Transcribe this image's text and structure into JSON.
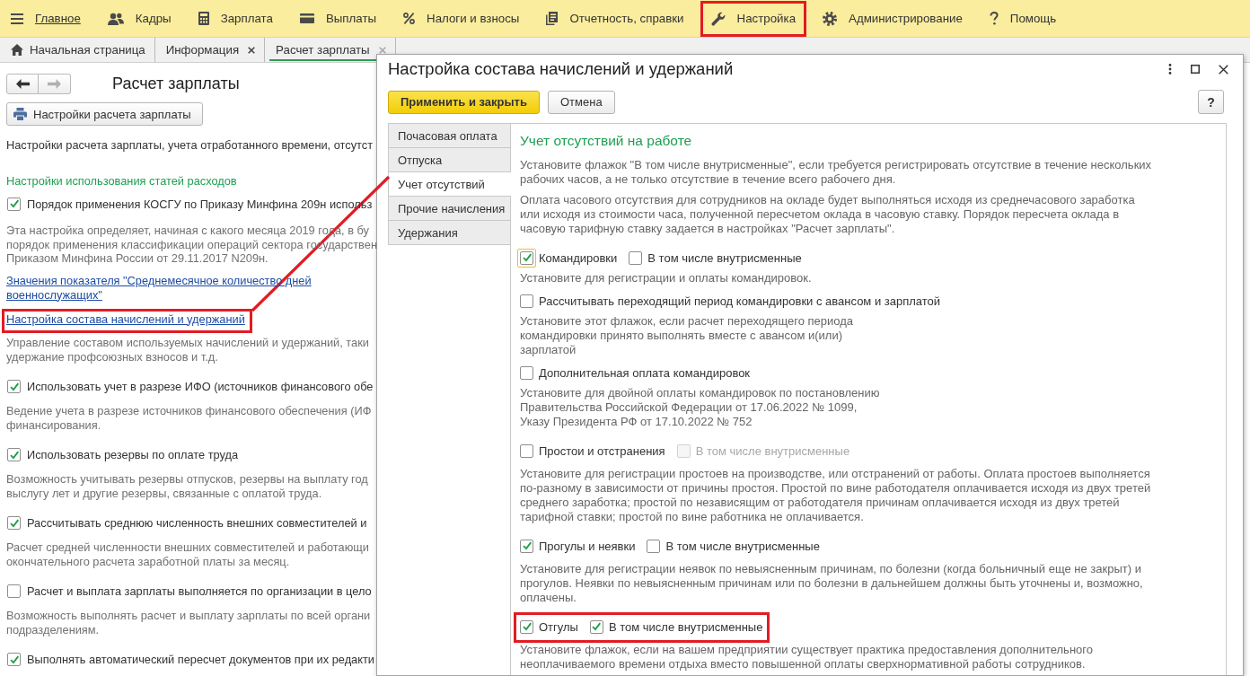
{
  "menu_bar": {
    "items": [
      {
        "label": "Главное",
        "selected": true,
        "highlighted": false
      },
      {
        "label": "Кадры",
        "selected": false,
        "highlighted": false
      },
      {
        "label": "Зарплата",
        "selected": false,
        "highlighted": false
      },
      {
        "label": "Выплаты",
        "selected": false,
        "highlighted": false
      },
      {
        "label": "Налоги и взносы",
        "selected": false,
        "highlighted": false
      },
      {
        "label": "Отчетность, справки",
        "selected": false,
        "highlighted": false
      },
      {
        "label": "Настройка",
        "selected": false,
        "highlighted": true
      },
      {
        "label": "Администрирование",
        "selected": false,
        "highlighted": false
      },
      {
        "label": "Помощь",
        "selected": false,
        "highlighted": false
      }
    ]
  },
  "tabs": [
    {
      "label": "Начальная страница",
      "closable": false,
      "selected": false
    },
    {
      "label": "Информация",
      "closable": true,
      "selected": false
    },
    {
      "label": "Расчет зарплаты",
      "closable": true,
      "selected": true
    }
  ],
  "page": {
    "nav_buttons": [
      {
        "disabled": false
      },
      {
        "disabled": true
      }
    ],
    "title": "Расчет зарплаты",
    "settings_button": "Настройки расчета зарплаты",
    "intro": "Настройки расчета зарплаты, учета отработанного времени, отсутст",
    "items": [
      {
        "kind": "heading",
        "text": "Настройки использования статей расходов"
      },
      {
        "kind": "checkbox",
        "label": "Порядок применения КОСГУ по Приказу Минфина 209н использ",
        "checked": true
      },
      {
        "kind": "description",
        "lines": [
          "Эта настройка определяет, начиная с какого месяца 2019 года, в бу",
          "порядок применения классификации операций сектора государствен",
          "Приказом Минфина России от 29.11.2017 N209н."
        ]
      },
      {
        "kind": "link",
        "lines": [
          "Значения показателя \"Среднемесячное количество дней",
          "военнослужащих\""
        ],
        "highlighted": false
      },
      {
        "kind": "link",
        "lines": [
          "Настройка состава начислений и удержаний"
        ],
        "highlighted": true
      },
      {
        "kind": "description",
        "lines": [
          "Управление составом используемых начислений и удержаний, таки",
          "удержание профсоюзных взносов и т.д."
        ]
      },
      {
        "kind": "checkbox",
        "label": "Использовать учет в разрезе ИФО (источников финансового обе",
        "checked": true
      },
      {
        "kind": "description",
        "lines": [
          "Ведение учета в разрезе источников финансового обеспечения (ИФ",
          "финансирования."
        ]
      },
      {
        "kind": "checkbox",
        "label": "Использовать резервы по оплате труда",
        "checked": true
      },
      {
        "kind": "description",
        "lines": [
          "Возможность учитывать резервы отпусков, резервы на выплату год",
          "выслугу лет и другие резервы, связанные с оплатой труда."
        ]
      },
      {
        "kind": "checkbox",
        "label": "Рассчитывать среднюю численность внешних совместителей и",
        "checked": true
      },
      {
        "kind": "description",
        "lines": [
          "Расчет средней численности внешних совместителей и работающи",
          "окончательного расчета заработной платы за месяц."
        ]
      },
      {
        "kind": "checkbox",
        "label": "Расчет и выплата зарплаты выполняется по организации в цело",
        "checked": false
      },
      {
        "kind": "description",
        "lines": [
          "Возможность выполнять расчет и выплату зарплаты по всей органи",
          "подразделениям."
        ]
      },
      {
        "kind": "checkbox",
        "label": "Выполнять автоматический пересчет документов при их редакти",
        "checked": true
      }
    ]
  },
  "dialog": {
    "title": "Настройка состава начислений и удержаний",
    "apply_button": "Применить и закрыть",
    "cancel_button": "Отмена",
    "help_button": "?",
    "tabs": [
      {
        "label": "Почасовая оплата",
        "selected": false
      },
      {
        "label": "Отпуска",
        "selected": false
      },
      {
        "label": "Учет отсутствий",
        "selected": true
      },
      {
        "label": "Прочие начисления",
        "selected": false
      },
      {
        "label": "Удержания",
        "selected": false
      }
    ],
    "panel": {
      "heading": "Учет отсутствий на работе",
      "notes": [
        {
          "lines": [
            "Установите флажок \"В том числе внутрисменные\", если требуется регистрировать отсутствие в течение нескольких",
            "рабочих часов, а не только отсутствие в течение всего рабочего дня."
          ]
        },
        {
          "lines": [
            "Оплата часового отсутствия для сотрудников на окладе будет выполняться исходя из среднечасового заработка",
            "или исходя из стоимости часа, полученной пересчетом оклада в часовую ставку. Порядок пересчета оклада в",
            "часовую тарифную ставку задается в настройках \"Расчет зарплаты\"."
          ]
        }
      ],
      "groups": [
        {
          "items": [
            {
              "kind": "row",
              "highlighted": false,
              "checks": [
                {
                  "label": "Командировки",
                  "checked": true,
                  "disabled": false,
                  "focused": true
                },
                {
                  "label": "В том числе внутрисменные",
                  "checked": false,
                  "disabled": false,
                  "focused": false
                }
              ]
            },
            {
              "kind": "description",
              "lines": [
                "Установите для регистрации и оплаты командировок."
              ]
            },
            {
              "kind": "row",
              "highlighted": false,
              "checks": [
                {
                  "label": "Рассчитывать переходящий период командировки с авансом и зарплатой",
                  "checked": false,
                  "disabled": false,
                  "focused": false
                }
              ]
            },
            {
              "kind": "description",
              "lines": [
                "Установите этот флажок, если расчет переходящего периода",
                "командировки принято выполнять вместе с авансом и(или)",
                "зарплатой"
              ]
            },
            {
              "kind": "row",
              "highlighted": false,
              "checks": [
                {
                  "label": "Дополнительная оплата командировок",
                  "checked": false,
                  "disabled": false,
                  "focused": false
                }
              ]
            },
            {
              "kind": "description",
              "lines": [
                "Установите для двойной оплаты командировок по постановлению",
                "Правительства Российской Федерации от 17.06.2022 № 1099,",
                "Указу Президента РФ от 17.10.2022 № 752"
              ]
            }
          ]
        },
        {
          "items": [
            {
              "kind": "row",
              "highlighted": false,
              "checks": [
                {
                  "label": "Простои и отстранения",
                  "checked": false,
                  "disabled": false,
                  "focused": false
                },
                {
                  "label": "В том числе внутрисменные",
                  "checked": false,
                  "disabled": true,
                  "focused": false
                }
              ]
            },
            {
              "kind": "description",
              "lines": [
                "Установите для регистрации простоев на производстве, или отстранений от работы. Оплата простоев выполняется",
                "по-разному в зависимости от причины простоя. Простой по вине работодателя оплачивается исходя из двух третей",
                "среднего заработка; простой по независящим от работодателя причинам оплачивается исходя из двух третей",
                "тарифной ставки; простой по вине работника не оплачивается."
              ]
            }
          ]
        },
        {
          "items": [
            {
              "kind": "row",
              "highlighted": false,
              "checks": [
                {
                  "label": "Прогулы и неявки",
                  "checked": true,
                  "disabled": false,
                  "focused": false
                },
                {
                  "label": "В том числе внутрисменные",
                  "checked": false,
                  "disabled": false,
                  "focused": false
                }
              ]
            },
            {
              "kind": "description",
              "lines": [
                "Установите для регистрации неявок по невыясненным причинам, по болезни (когда больничный еще не закрыт) и",
                "прогулов. Неявки по невыясненным причинам или по болезни в дальнейшем должны быть уточнены и, возможно,",
                "оплачены."
              ]
            }
          ]
        },
        {
          "items": [
            {
              "kind": "row",
              "highlighted": true,
              "checks": [
                {
                  "label": "Отгулы",
                  "checked": true,
                  "disabled": false,
                  "focused": false
                },
                {
                  "label": "В том числе внутрисменные",
                  "checked": true,
                  "disabled": false,
                  "focused": false
                }
              ]
            },
            {
              "kind": "description",
              "lines": [
                "Установите флажок, если на вашем предприятии существует практика предоставления дополнительного",
                "неоплачиваемого времени отдыха вместо повышенной оплаты сверхнормативной работы сотрудников."
              ]
            }
          ]
        }
      ]
    }
  }
}
